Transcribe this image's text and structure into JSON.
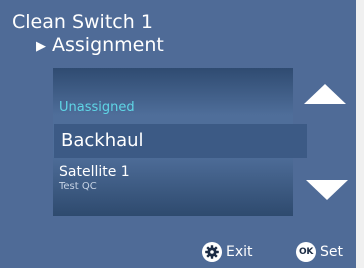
{
  "header": {
    "title": "Clean Switch 1",
    "breadcrumb_marker": "▶",
    "subtitle": "Assignment"
  },
  "list": {
    "items": [
      {
        "label": "Unassigned",
        "sub": ""
      },
      {
        "label": "Backhaul",
        "sub": ""
      },
      {
        "label": "Satellite 1",
        "sub": "Test QC"
      }
    ],
    "selected_index": 1
  },
  "nav": {
    "up_icon": "triangle-up",
    "down_icon": "triangle-down"
  },
  "footer": {
    "exit_label": "Exit",
    "exit_icon": "gear-icon",
    "set_label": "Set",
    "set_icon_text": "OK"
  },
  "colors": {
    "background": "#4f6b97",
    "highlight_row": "#3c5a85",
    "unassigned_text": "#5fd6e6",
    "text": "#ffffff"
  }
}
